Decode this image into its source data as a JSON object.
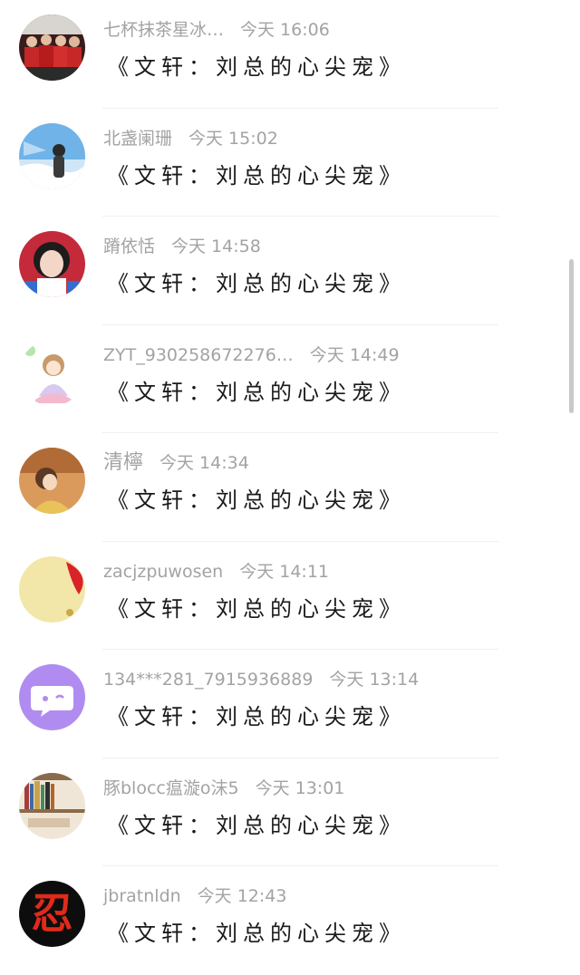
{
  "comments": [
    {
      "name": "七杯抹茶星冰…",
      "time": "今天 16:06",
      "text": "《文轩：刘总的心尖宠》",
      "avatar": "group-photo-avatar"
    },
    {
      "name": "北盏阑珊",
      "time": "今天 15:02",
      "text": "《文轩：刘总的心尖宠》",
      "avatar": "blue-sky-girl-avatar"
    },
    {
      "name": "蹐依恬",
      "time": "今天 14:58",
      "text": "《文轩：刘总的心尖宠》",
      "avatar": "girl-portrait-avatar"
    },
    {
      "name": "ZYT_930258672276…",
      "time": "今天 14:49",
      "text": "《文轩：刘总的心尖宠》",
      "avatar": "cartoon-girl-avatar"
    },
    {
      "name": "清檸",
      "time": "今天 14:34",
      "text": "《文轩：刘总的心尖宠》",
      "avatar": "illustrated-girl-avatar"
    },
    {
      "name": "zacjzpuwosen",
      "time": "今天 14:11",
      "text": "《文轩：刘总的心尖宠》",
      "avatar": "yellow-red-avatar"
    },
    {
      "name": "134***281_7915936889",
      "time": "今天 13:14",
      "text": "《文轩：刘总的心尖宠》",
      "avatar": "purple-chat-bubble-avatar"
    },
    {
      "name": "豚blocc瘟漩o沫5",
      "time": "今天 13:01",
      "text": "《文轩：刘总的心尖宠》",
      "avatar": "bookshelf-avatar"
    },
    {
      "name": "jbratnldn",
      "time": "今天 12:43",
      "text": "《文轩：刘总的心尖宠》",
      "avatar": "ninja-character-avatar",
      "avatar_text": "忍"
    }
  ],
  "colors": {
    "meta_text": "#a3a3a3",
    "comment_text": "#1a1a1a",
    "separator": "#efefef",
    "background": "#ffffff"
  }
}
